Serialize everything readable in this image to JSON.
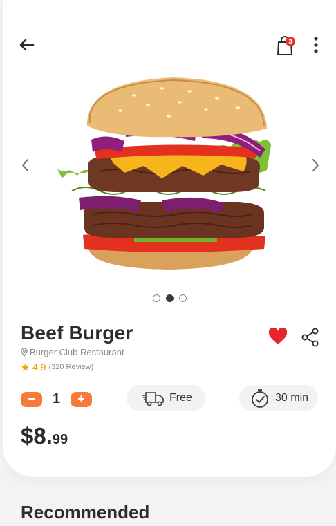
{
  "header": {
    "back_icon": "arrow-left-icon",
    "cart_icon": "shopping-bag-icon",
    "cart_badge": "3",
    "more_icon": "vertical-dots-icon"
  },
  "carousel": {
    "image_alt": "Beef Burger",
    "image_icon": "burger-photo",
    "prev_icon": "chevron-left-icon",
    "next_icon": "chevron-right-icon",
    "page_count": 3,
    "active_index": 1
  },
  "product": {
    "name": "Beef Burger",
    "restaurant": "Burger Club Restaurant",
    "rating": "4.9",
    "reviews": "(320 Review)",
    "favorited": true,
    "share_icon": "share-icon",
    "heart_icon": "heart-icon"
  },
  "order": {
    "minus_label": "−",
    "plus_label": "+",
    "quantity": "1",
    "delivery_label": "Free",
    "time_label": "30 min",
    "price_main": "$8.",
    "price_cents": "99"
  },
  "recommended": {
    "title": "Recommended"
  },
  "colors": {
    "accent": "#f47b3a",
    "heart": "#e8242c",
    "badge": "#e8362d",
    "star": "#f2a300"
  }
}
